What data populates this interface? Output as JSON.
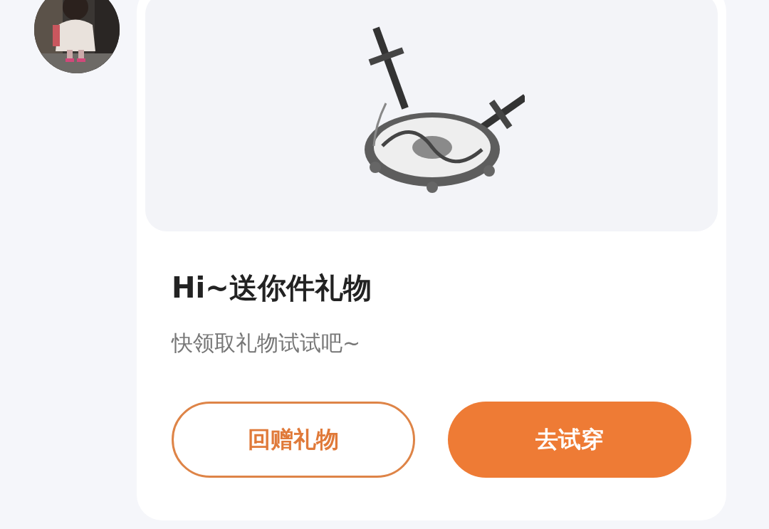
{
  "card": {
    "title": "Hi~送你件礼物",
    "subtitle": "快领取礼物试试吧~",
    "buttons": [
      {
        "label": "回赠礼物",
        "kind": "outline"
      },
      {
        "label": "去试穿",
        "kind": "filled"
      }
    ]
  }
}
